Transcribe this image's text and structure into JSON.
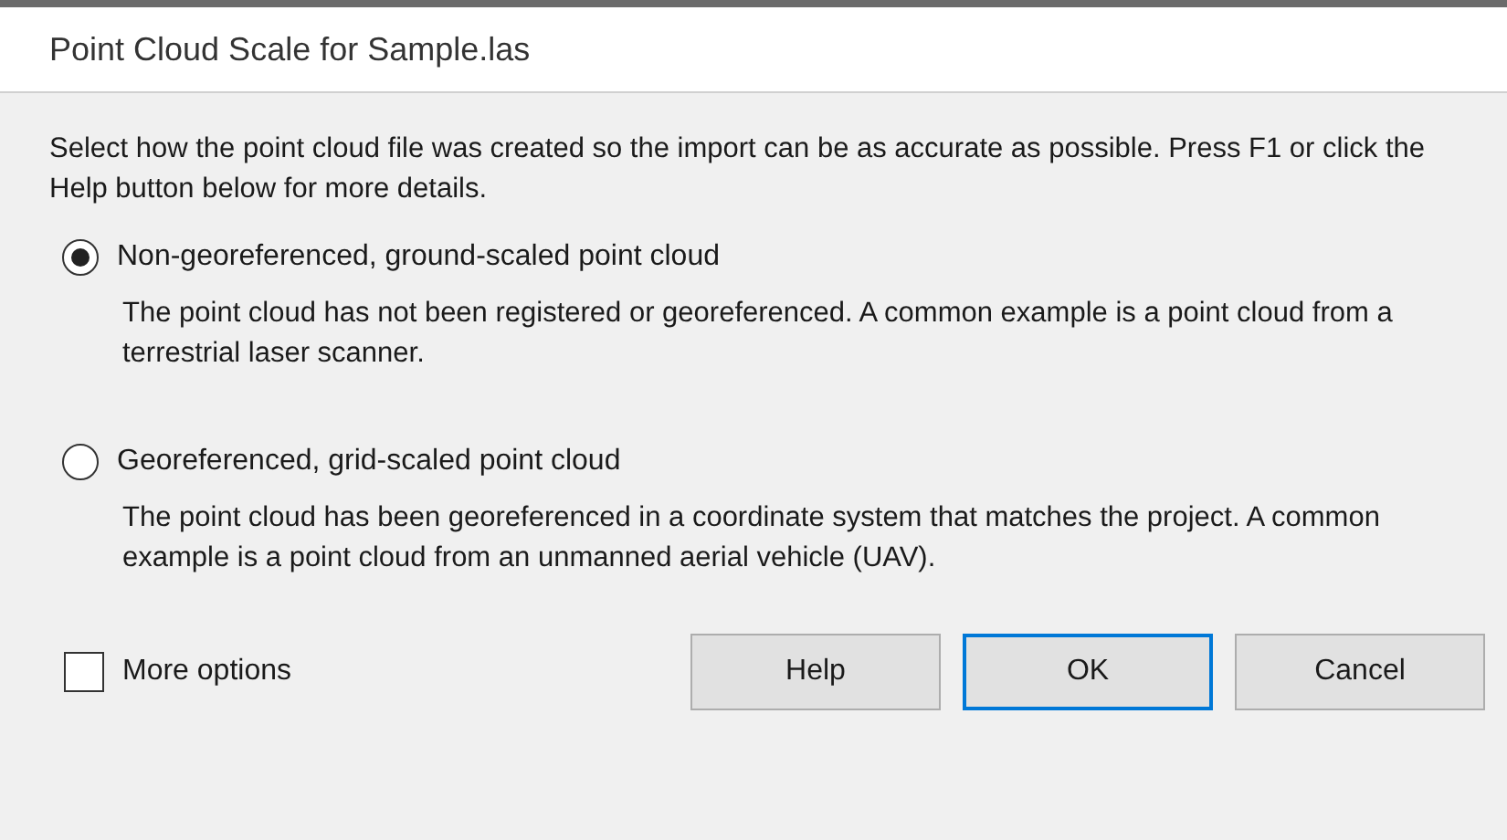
{
  "window": {
    "title": "Point Cloud Scale for Sample.las"
  },
  "intro": "Select how the point cloud file was created so the import can be as accurate as possible. Press F1 or click the Help button below for more details.",
  "options": [
    {
      "label": "Non-georeferenced, ground-scaled point cloud",
      "description": "The point cloud has not been registered or georeferenced. A common example is a point cloud from a terrestrial laser scanner.",
      "selected": true
    },
    {
      "label": "Georeferenced, grid-scaled point cloud",
      "description": "The point cloud has been georeferenced in a coordinate system that matches the project. A common example is a point cloud from an unmanned aerial vehicle (UAV).",
      "selected": false
    }
  ],
  "more_options": {
    "label": "More options",
    "checked": false
  },
  "buttons": [
    {
      "label": "Help",
      "default": false
    },
    {
      "label": "OK",
      "default": true
    },
    {
      "label": "Cancel",
      "default": false
    }
  ]
}
